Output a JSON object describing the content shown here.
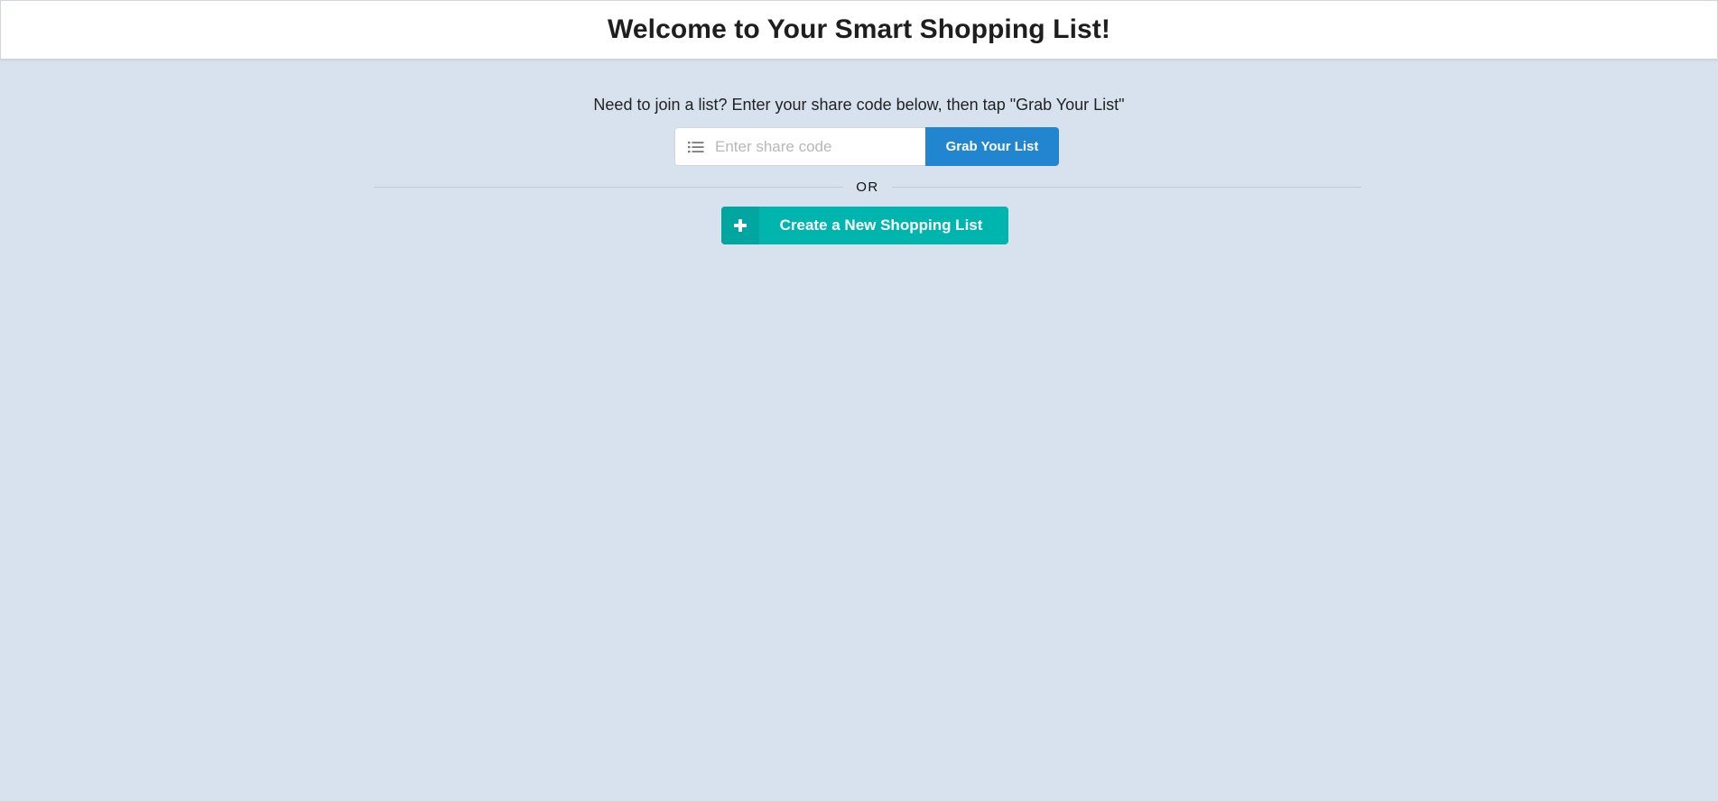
{
  "header": {
    "title": "Welcome to Your Smart Shopping List!"
  },
  "join": {
    "instructions": "Need to join a list? Enter your share code below, then tap \"Grab Your List\"",
    "input_placeholder": "Enter share code",
    "input_value": "",
    "input_icon": "list-icon",
    "grab_button_label": "Grab Your List"
  },
  "divider": {
    "label": "OR"
  },
  "create": {
    "button_label": "Create a New Shopping List",
    "button_icon": "plus-icon"
  },
  "colors": {
    "background": "#d8e2ee",
    "primary_blue": "#2185d0",
    "teal": "#00b5ad"
  }
}
